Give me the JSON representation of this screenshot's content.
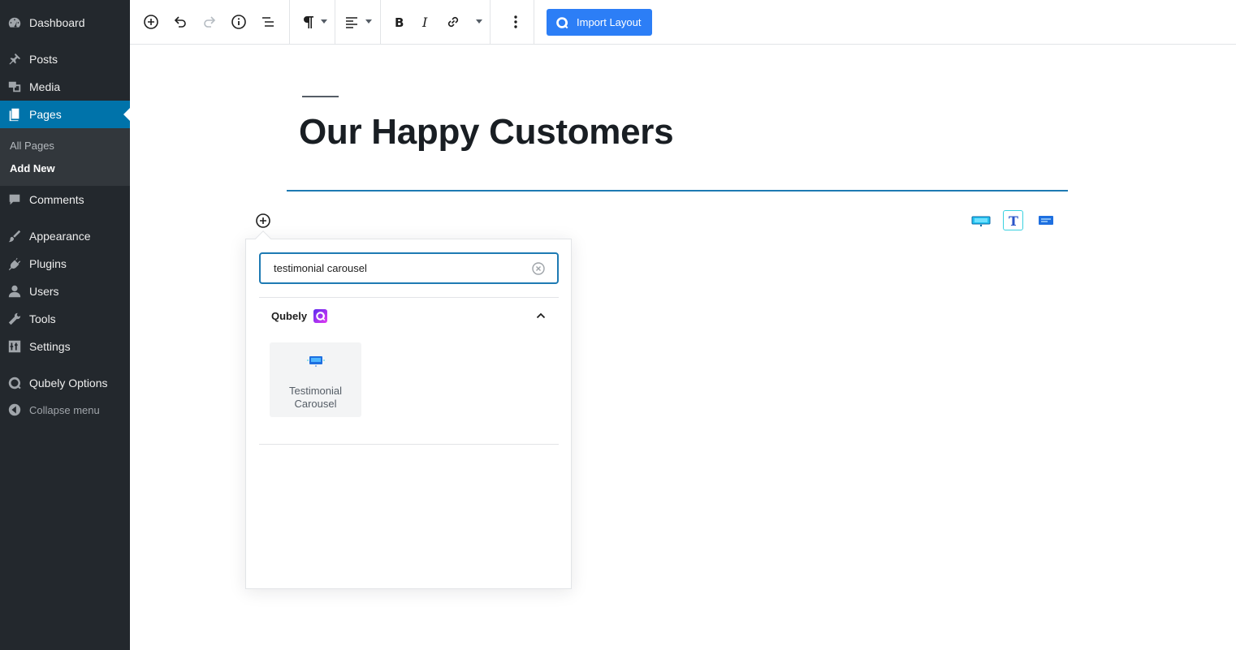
{
  "sidebar": {
    "items": [
      {
        "label": "Dashboard",
        "icon": "dashboard-icon"
      },
      {
        "label": "Posts",
        "icon": "pin-icon"
      },
      {
        "label": "Media",
        "icon": "media-icon"
      },
      {
        "label": "Pages",
        "icon": "pages-icon",
        "active": true
      },
      {
        "label": "Comments",
        "icon": "comment-icon"
      },
      {
        "label": "Appearance",
        "icon": "brush-icon"
      },
      {
        "label": "Plugins",
        "icon": "plug-icon"
      },
      {
        "label": "Users",
        "icon": "user-icon"
      },
      {
        "label": "Tools",
        "icon": "wrench-icon"
      },
      {
        "label": "Settings",
        "icon": "sliders-icon"
      },
      {
        "label": "Qubely Options",
        "icon": "qubely-q-icon"
      }
    ],
    "submenu": {
      "all_pages": "All Pages",
      "add_new": "Add New"
    },
    "collapse_label": "Collapse menu"
  },
  "toolbar": {
    "import_label": "Import Layout",
    "accent": "#2c7ef6"
  },
  "editor": {
    "title": "Our Happy Customers"
  },
  "inserter": {
    "search_value": "testimonial carousel",
    "panel_title": "Qubely",
    "block_label": "Testimonial Carousel",
    "accent": "#1e7ab3"
  }
}
